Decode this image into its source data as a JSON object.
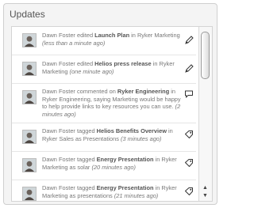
{
  "panel": {
    "title": "Updates"
  },
  "scrollbar": {
    "up_arrow": "▲",
    "down_arrow": "▼"
  },
  "updates": [
    {
      "actor": "Dawn Foster",
      "verb": " edited ",
      "object": "Launch Plan",
      "mid": " in ",
      "target": "Ryker Marketing",
      "time": "(less than a minute ago)",
      "action_icon": "pencil-icon"
    },
    {
      "actor": "Dawn Foster",
      "verb": " edited ",
      "object": "Helios press release",
      "mid": " in ",
      "target": "Ryker Marketing",
      "time": "(one minute ago)",
      "action_icon": "pencil-icon"
    },
    {
      "actor": "Dawn Foster",
      "verb": " commented on ",
      "object": "Ryker Engineering",
      "mid": " in ",
      "target": "Ryker Engineering",
      "comment": ", saying Marketing would be happy to help provide links to key resources you can use.",
      "time": "(2 minutes ago)",
      "action_icon": "comment-icon"
    },
    {
      "actor": "Dawn Foster",
      "verb": " tagged ",
      "object": "Helios Benefits Overview",
      "mid": " in ",
      "target": "Ryker Sales",
      "tagword": " as ",
      "tag": "Presentations",
      "time": "(3 minutes ago)",
      "action_icon": "tag-icon"
    },
    {
      "actor": "Dawn Foster",
      "verb": " tagged ",
      "object": "Energy Presentation",
      "mid": " in ",
      "target": "Ryker Marketing",
      "tagword": " as ",
      "tag": "solar",
      "time": "(20 minutes ago)",
      "action_icon": "tag-icon"
    },
    {
      "actor": "Dawn Foster",
      "verb": " tagged ",
      "object": "Energy Presentation",
      "mid": " in ",
      "target": "Ryker Marketing",
      "tagword": " as ",
      "tag": "presentations",
      "time": "(21 minutes ago)",
      "action_icon": "tag-icon"
    }
  ],
  "colors": {
    "link": "#555555",
    "text": "#777777",
    "panel_bg": "#f4f4f4"
  }
}
